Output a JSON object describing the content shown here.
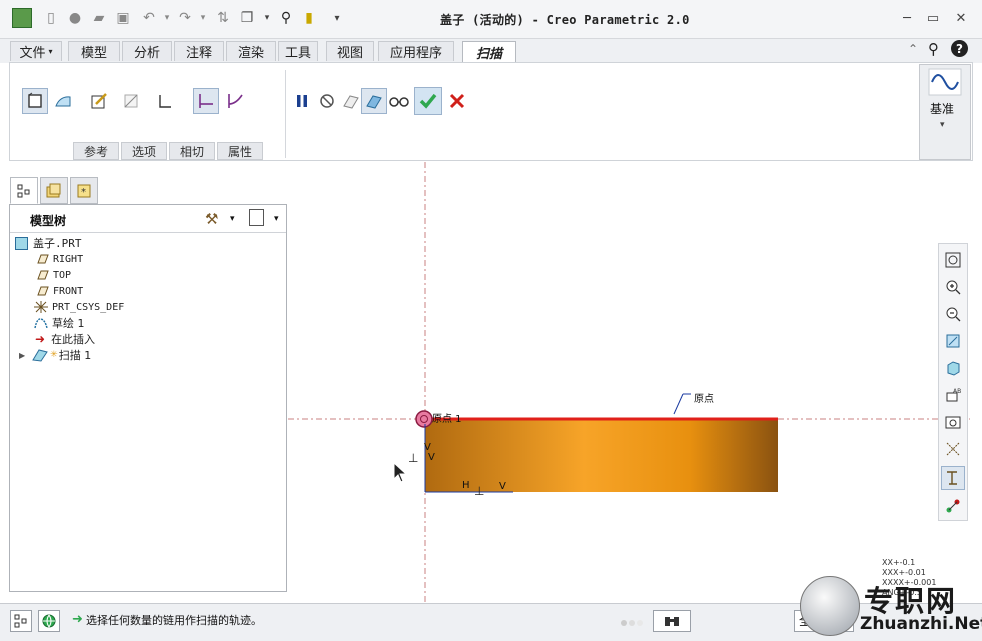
{
  "window": {
    "title": "盖子 (活动的) - Creo Parametric 2.0"
  },
  "menu_tabs": [
    {
      "label": "文件"
    },
    {
      "label": "模型"
    },
    {
      "label": "分析"
    },
    {
      "label": "注释"
    },
    {
      "label": "渲染"
    },
    {
      "label": "工具"
    },
    {
      "label": "视图"
    },
    {
      "label": "应用程序"
    },
    {
      "label": "扫描",
      "active": true
    }
  ],
  "ribbon": {
    "subtabs": [
      "参考",
      "选项",
      "相切",
      "属性"
    ],
    "datum_label": "基准"
  },
  "model_tree": {
    "title": "模型树",
    "nodes": [
      {
        "label": "盖子.PRT",
        "icon": "part-icon"
      },
      {
        "label": "RIGHT",
        "icon": "datum-plane-icon"
      },
      {
        "label": "TOP",
        "icon": "datum-plane-icon"
      },
      {
        "label": "FRONT",
        "icon": "datum-plane-icon"
      },
      {
        "label": "PRT_CSYS_DEF",
        "icon": "csys-icon"
      },
      {
        "label": "草绘 1",
        "icon": "sketch-icon"
      },
      {
        "label": "在此插入",
        "icon": "insert-arrow-icon"
      },
      {
        "label": "扫描 1",
        "icon": "sweep-feature-icon"
      }
    ]
  },
  "graphics": {
    "origin_label": "原点",
    "trajectory_label": "原点 1",
    "h_label": "H",
    "v_label": "V",
    "tolerance": [
      "XX+-0.1",
      "XXX+-0.01",
      "XXXX+-0.001",
      "ANG+-0.5"
    ]
  },
  "status": {
    "message": "选择任何数量的链用作扫描的轨迹。",
    "filter_label": "全部"
  },
  "watermark": {
    "text_cn": "专职网",
    "text_en": "Zhuanzhi.Net"
  },
  "colors": {
    "trajectory": "#e0201a",
    "sweep_body": "#e8900f",
    "confirm_green": "#2fa84f",
    "cancel_red": "#d0201a"
  }
}
